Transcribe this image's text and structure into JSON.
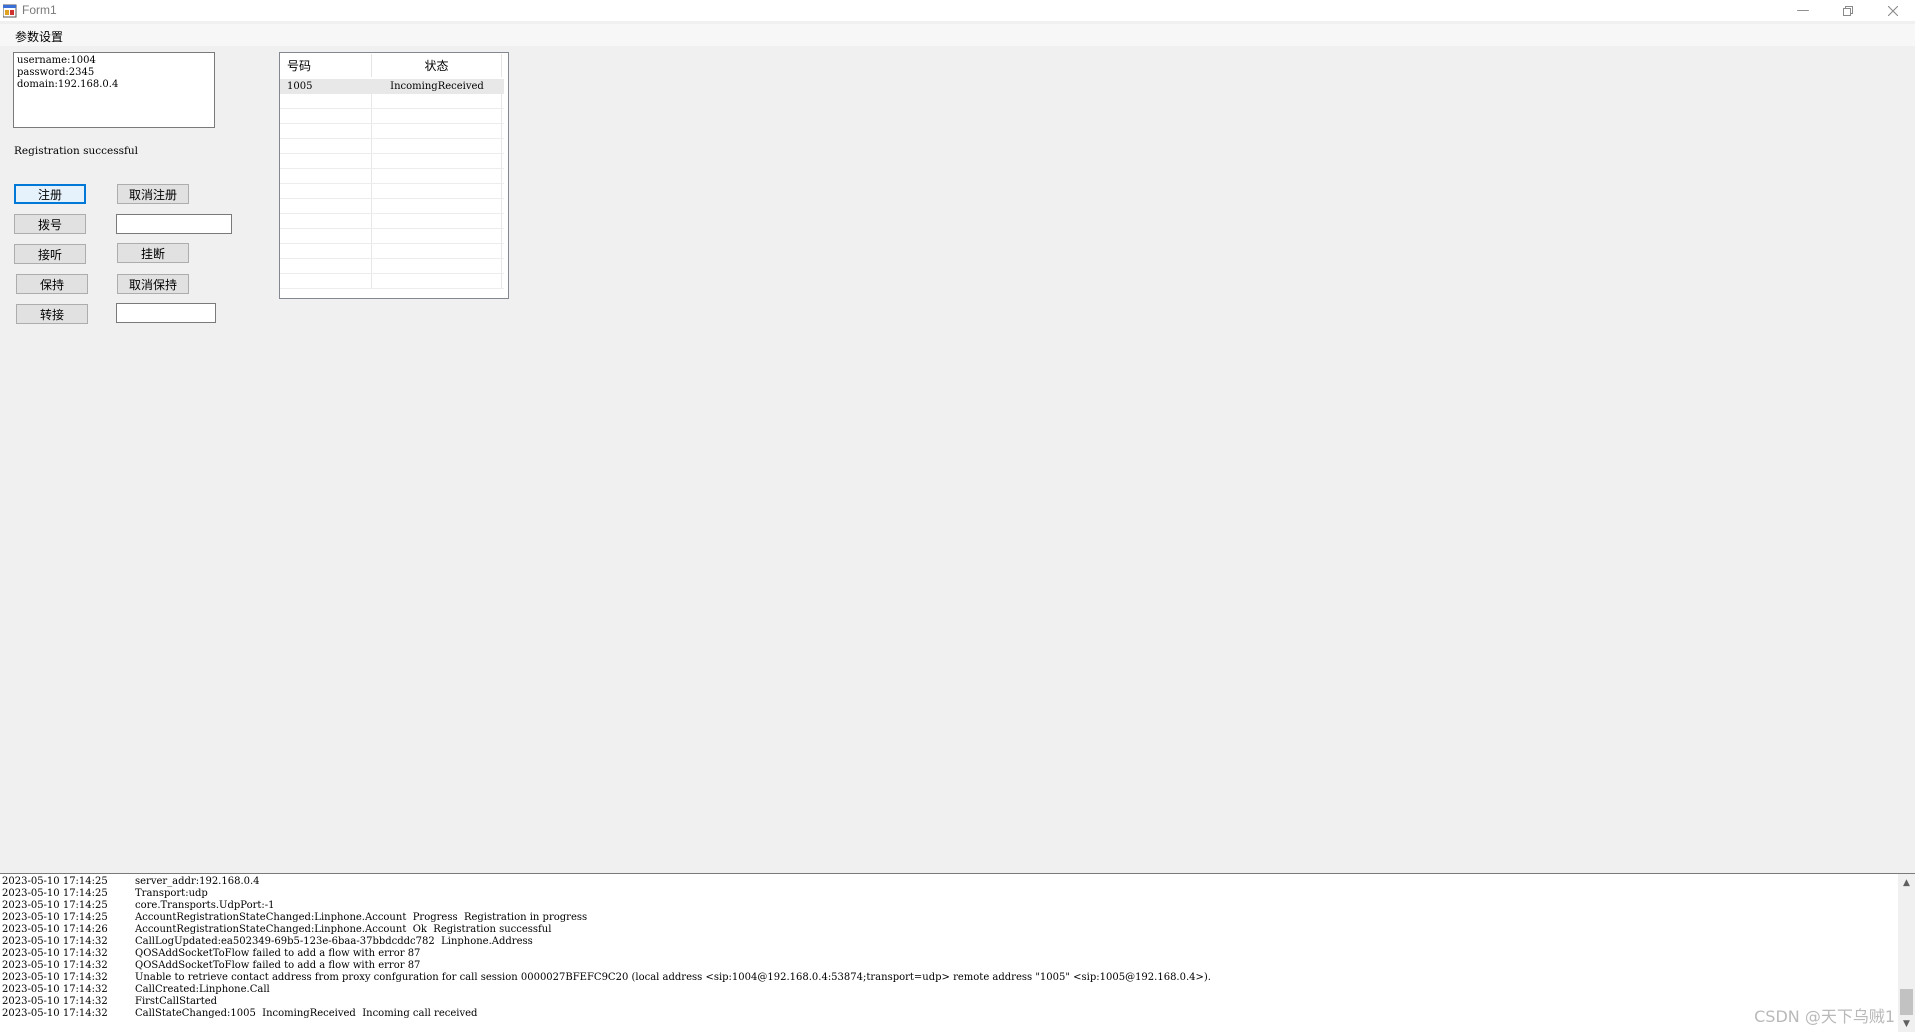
{
  "window": {
    "title": "Form1"
  },
  "menu": {
    "item": "参数设置"
  },
  "params": {
    "lines": [
      "username:1004",
      "password:2345",
      "domain:192.168.0.4"
    ]
  },
  "status_text": "Registration successful",
  "buttons": {
    "register": "注册",
    "unregister": "取消注册",
    "dial": "拨号",
    "answer": "接听",
    "hangup": "挂断",
    "hold": "保持",
    "unhold": "取消保持",
    "transfer": "转接"
  },
  "inputs": {
    "dial_value": "",
    "transfer_value": ""
  },
  "grid": {
    "headers": [
      "号码",
      "状态"
    ],
    "rows": [
      {
        "number": "1005",
        "state": "IncomingReceived"
      }
    ]
  },
  "log": [
    {
      "time": "2023-05-10 17:14:25",
      "msg": "server_addr:192.168.0.4"
    },
    {
      "time": "2023-05-10 17:14:25",
      "msg": "Transport:udp"
    },
    {
      "time": "2023-05-10 17:14:25",
      "msg": "core.Transports.UdpPort:-1"
    },
    {
      "time": "2023-05-10 17:14:25",
      "msg": "AccountRegistrationStateChanged:Linphone.Account  Progress  Registration in progress"
    },
    {
      "time": "2023-05-10 17:14:26",
      "msg": "AccountRegistrationStateChanged:Linphone.Account  Ok  Registration successful"
    },
    {
      "time": "2023-05-10 17:14:32",
      "msg": "CallLogUpdated:ea502349-69b5-123e-6baa-37bbdcddc782  Linphone.Address"
    },
    {
      "time": "2023-05-10 17:14:32",
      "msg": "QOSAddSocketToFlow failed to add a flow with error 87"
    },
    {
      "time": "2023-05-10 17:14:32",
      "msg": "QOSAddSocketToFlow failed to add a flow with error 87"
    },
    {
      "time": "2023-05-10 17:14:32",
      "msg": "Unable to retrieve contact address from proxy confguration for call session 0000027BFEFC9C20 (local address <sip:1004@192.168.0.4:53874;transport=udp> remote address \"1005\" <sip:1005@192.168.0.4>)."
    },
    {
      "time": "2023-05-10 17:14:32",
      "msg": "CallCreated:Linphone.Call"
    },
    {
      "time": "2023-05-10 17:14:32",
      "msg": "FirstCallStarted"
    },
    {
      "time": "2023-05-10 17:14:32",
      "msg": "CallStateChanged:1005  IncomingReceived  Incoming call received"
    }
  ],
  "watermark": "CSDN @天下乌贼1"
}
